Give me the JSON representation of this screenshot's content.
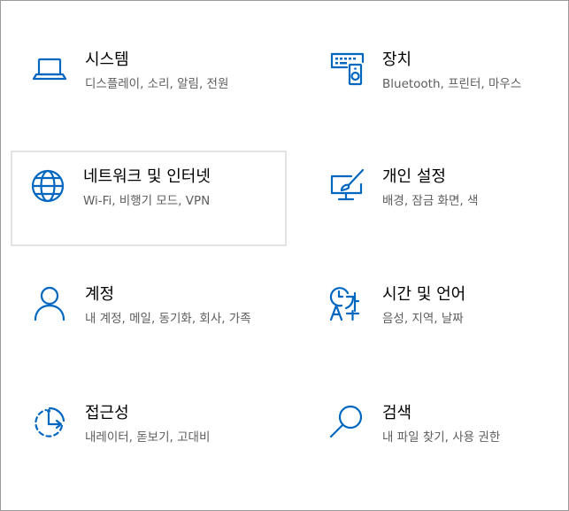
{
  "settings": {
    "tiles": [
      {
        "icon": "laptop-icon",
        "title": "시스템",
        "description": "디스플레이, 소리, 알림, 전원"
      },
      {
        "icon": "keyboard-speaker-icon",
        "title": "장치",
        "description": "Bluetooth, 프린터, 마우스"
      },
      {
        "icon": "globe-icon",
        "title": "네트워크 및 인터넷",
        "description": "Wi-Fi, 비행기 모드, VPN"
      },
      {
        "icon": "paint-monitor-icon",
        "title": "개인 설정",
        "description": "배경, 잠금 화면, 색"
      },
      {
        "icon": "person-icon",
        "title": "계정",
        "description": "내 계정, 메일, 동기화, 회사, 가족"
      },
      {
        "icon": "time-language-icon",
        "title": "시간 및 언어",
        "description": "음성, 지역, 날짜"
      },
      {
        "icon": "ease-of-access-icon",
        "title": "접근성",
        "description": "내레이터, 돋보기, 고대비"
      },
      {
        "icon": "search-icon",
        "title": "검색",
        "description": "내 파일 찾기, 사용 권한"
      }
    ]
  },
  "colors": {
    "accent": "#0067c0",
    "description_text": "#5d5d5d",
    "focus_border": "#e3e3e3"
  }
}
